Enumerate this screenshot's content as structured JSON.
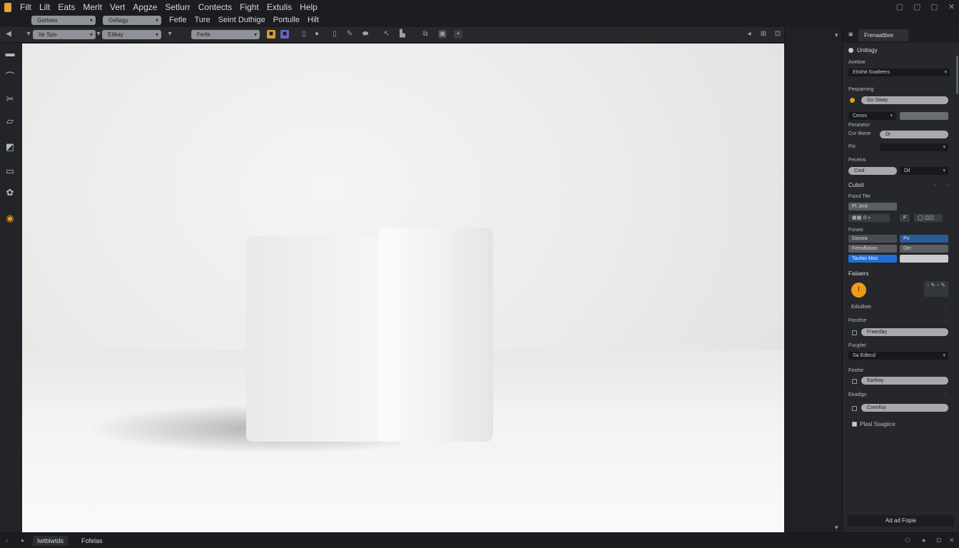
{
  "menu": {
    "row1": [
      "Filt",
      "Lilt",
      "Eats",
      "Merlt",
      "Vert",
      "Apgze",
      "Setlurr",
      "Contects",
      "Fight",
      "Extulis",
      "Help"
    ],
    "row2": [
      "Fetle",
      "Ture",
      "Seint Duthige",
      "Portulle",
      "Hilt"
    ]
  },
  "window_controls": [
    "▢",
    "▢",
    "▢",
    "✕"
  ],
  "toolbar": {
    "select1": "Ite Spo",
    "select2": "Eitkay",
    "select3": "Ferfe",
    "menu_select1": "Gortoes",
    "menu_select2": "Geltagy",
    "icons": [
      "◀",
      "▾",
      "▾",
      "▾",
      "■",
      "■",
      "▯",
      "●",
      "▯",
      "✎",
      "⬬",
      "↖",
      "▙",
      "⧉",
      "▣",
      "▪"
    ],
    "right_icons": [
      "◂",
      "⊞",
      "⊡",
      "⇱",
      "—",
      "▢"
    ]
  },
  "leftbar": {
    "icons": [
      "‹",
      "▬",
      "⌒",
      "✂",
      "▱",
      "◩",
      "▭",
      "✿",
      "◉"
    ]
  },
  "midstrip": {
    "icons": [
      "▾",
      "▾"
    ]
  },
  "panel": {
    "tab_label": "Frenaatttee",
    "section_title": "Unitisgy",
    "rows": {
      "label1": "Anetioe",
      "dropdown1": "Elsithit Soatleers",
      "label2": "Pexparning",
      "pill1": "Go Staay",
      "dropdown2": "Cesos",
      "label3": "Fecaseicr",
      "label3b": "Cur ilkeve",
      "pill2": "Di",
      "label4": "Fio",
      "label5": "Feceins",
      "pill3": "Cool",
      "dropdown3": "Dil",
      "section2": "Culisit",
      "label6": "Fooul Tite",
      "dropdown4": "Pl..lerd",
      "grey1": "▦▦ ⊙ ▪",
      "grey2": "F",
      "grey3": "◯ ◫◫",
      "label7": "Forwis",
      "grey4": "Dasiva",
      "bluedim1": "Po",
      "grey5": "Fetraffotion",
      "grey6": "Der",
      "blue1": "Taufao Mos",
      "section3": "Faiiaers",
      "swatch_glyph": "!",
      "swatch_tools": "▫ ✎ ▫ ✎",
      "label8": "Edisillote",
      "label9": "Fecofne",
      "pill4": "Fraerday",
      "label10": "Fucgilet",
      "dropdown5": "Sa Edlecd",
      "label11": "Fesihe",
      "pill5": "Earfiiay",
      "label12": "Eeatilgo",
      "pill6": "Coenlisy",
      "check_label": "Plasl Ssagiice",
      "footer": "Ad ad Fopie"
    }
  },
  "statusbar": {
    "tab1": "Iwtblwtds",
    "tab2": "Fofelas",
    "right_icons": [
      "⬭",
      "●",
      "⊡",
      "✕"
    ]
  },
  "colors": {
    "accent_orange": "#f09a1a",
    "accent_blue": "#1f6fd6"
  }
}
